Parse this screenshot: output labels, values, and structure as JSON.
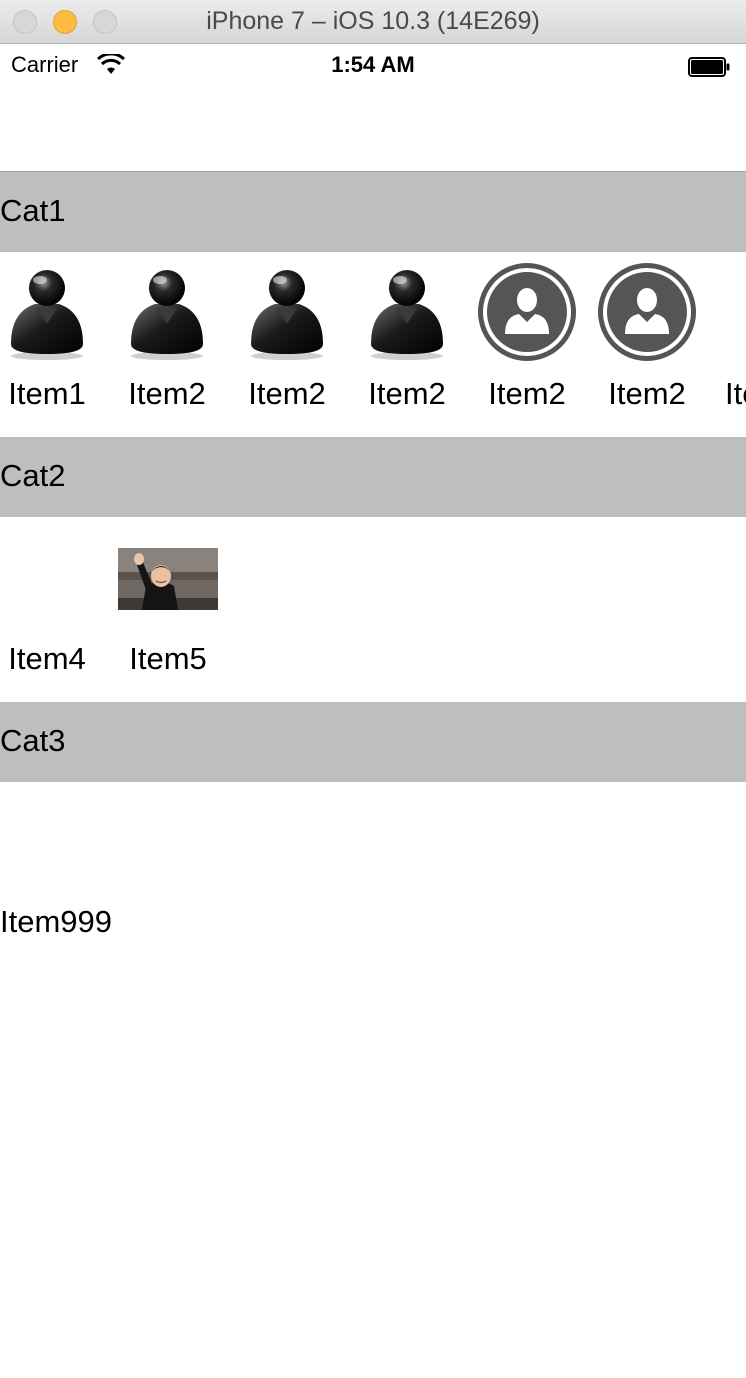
{
  "window": {
    "title": "iPhone 7 – iOS 10.3 (14E269)"
  },
  "status_bar": {
    "carrier": "Carrier",
    "time": "1:54 AM"
  },
  "sections": [
    {
      "title": "Cat1",
      "items": [
        "Item1",
        "Item2",
        "Item2",
        "Item2",
        "Item2",
        "Item2",
        "Ite"
      ]
    },
    {
      "title": "Cat2",
      "items": [
        "Item4",
        "Item5"
      ]
    },
    {
      "title": "Cat3",
      "items": [
        "Item999"
      ]
    }
  ],
  "colors": {
    "section_header": "#bebebe",
    "icon_dark": "#555555"
  },
  "icons": [
    "glossy-person-icon",
    "circle-person-icon",
    "person-photo"
  ]
}
